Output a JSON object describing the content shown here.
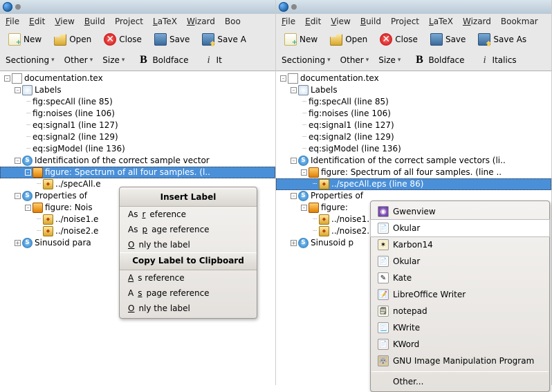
{
  "menus": {
    "file": "File",
    "file_k": "F",
    "edit": "Edit",
    "edit_k": "E",
    "view": "View",
    "view_k": "V",
    "build": "Build",
    "build_k": "B",
    "project": "Project",
    "latex": "LaTeX",
    "latex_k": "L",
    "wizard": "Wizard",
    "wizard_k": "W",
    "bookmarks_left": "Boo",
    "bookmarks_right": "Bookmar"
  },
  "toolbar": {
    "new": "New",
    "open": "Open",
    "close": "Close",
    "save": "Save",
    "saveas_left": "Save A",
    "saveas_right": "Save As"
  },
  "toolbar2": {
    "sectioning": "Sectioning",
    "other": "Other",
    "size": "Size",
    "boldface": "Boldface",
    "italics_left": "It",
    "italics_right": "Italics"
  },
  "tree": {
    "root": "documentation.tex",
    "labels": "Labels",
    "l1": "fig:specAll (line 85)",
    "l2": "fig:noises (line 106)",
    "l3": "eq:signal1 (line 127)",
    "l4": "eq:signal2 (line 129)",
    "l5": "eq:sigModel (line 136)",
    "sec1_left": "Identification of the correct sample vector",
    "sec1_right": "Identification of the correct sample vectors (li..",
    "fig1_left": "figure: Spectrum of all four samples. (l..",
    "fig1_right": "figure: Spectrum of all four samples. (line ..",
    "eps1_left": "../specAll.e",
    "eps1_right": "../specAll.eps (line 86)",
    "sec2_left": "Properties of",
    "sec2_right": "Properties of",
    "fig2_left": "figure: Nois",
    "fig2_right": "figure:",
    "eps2a_left": "../noise1.e",
    "eps2a_right": "../noise1.",
    "eps2b_left": "../noise2.e",
    "eps2b_right": "../noise2.",
    "sec3_left": "Sinusoid para",
    "sec3_right": "Sinusoid p"
  },
  "labelmenu": {
    "h1": "Insert Label",
    "asref": "As reference",
    "asref_k": "r",
    "aspage": "As page reference",
    "aspage_k": "p",
    "only": "Only the label",
    "only_k": "O",
    "h2": "Copy Label to Clipboard",
    "asref2": "As reference",
    "asref2_k": "A",
    "aspage2": "As page reference",
    "aspage2_k": "s",
    "only2": "Only the label",
    "only2_k": "O"
  },
  "appmenu": {
    "gwenview": "Gwenview",
    "okular": "Okular",
    "karbon": "Karbon14",
    "okular2": "Okular",
    "kate": "Kate",
    "writer": "LibreOffice Writer",
    "notepad": "notepad",
    "kwrite": "KWrite",
    "kword": "KWord",
    "gimp": "GNU Image Manipulation Program",
    "other": "Other..."
  }
}
